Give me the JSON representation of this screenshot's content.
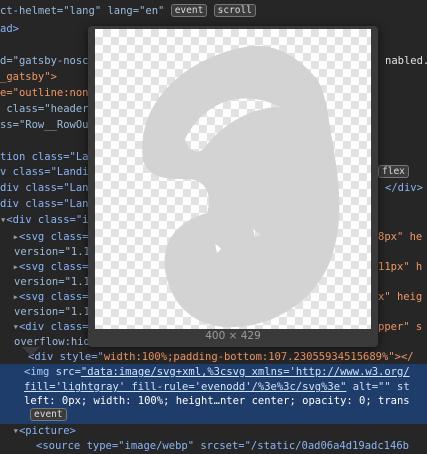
{
  "dom_lines": [
    "ct-helmet=\"lang\" lang=\"en\"",
    "ad>",
    "d=\"gatsby-nosc",
    "_gatsby\">",
    "e=\"outline:none",
    " class=\"header_",
    "ss=\"Row__RowOu",
    "tion class=\"Lan",
    "v class=\"Landi",
    "div class=\"Lan",
    "div class=\"Lan",
    "<div class=\"in",
    "<svg class=\"",
    "version=\"1.1",
    "<svg class=\"",
    "version=\"1.1",
    "<svg class=\"",
    "version=\"1.1",
    "<div class=\"",
    "overflow:hid",
    "<div style=\"",
    "width:100%;padding-bottom:107.23055934515689%\"></"
  ],
  "right_fragments": {
    "r3": "nabled.",
    "r10": "</div>",
    "r13": "8px\" he",
    "r15": "11px\" h",
    "r17": "x\" heig",
    "r19": "pper\" s"
  },
  "badges": {
    "event": "event",
    "scroll": "scroll",
    "flex": "flex"
  },
  "selected": {
    "tag_open": "<img",
    "src_attr": "src=",
    "src_value": "\"data:image/svg+xml,%3csvg xmlns='http://www.w3.org/",
    "line2": "fill='lightgray' fill-rule='evenodd'/%3e%3c/svg%3e\"",
    "alt": "alt=\"\"",
    "tail2": "st",
    "line3": "left: 0px; width: 100%; height…nter center; opacity: 0; trans"
  },
  "picture_line": "<picture>",
  "source_line": "<source type=\"image/webp\" srcset=\"/static/0ad06a4d19adc146b",
  "tooltip": {
    "dimensions": "400 × 429",
    "fill_color": "#d3d3d3"
  }
}
